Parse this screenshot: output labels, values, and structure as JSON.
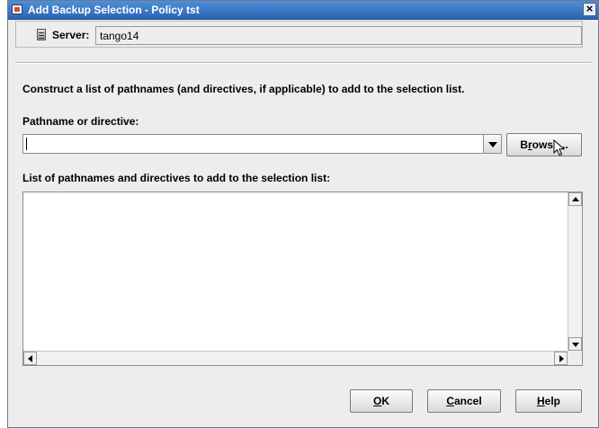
{
  "window": {
    "title": "Add Backup Selection - Policy tst",
    "close_glyph": "×"
  },
  "server": {
    "label": "Server:",
    "value": "tango14",
    "icon": "server-icon"
  },
  "instructions": "Construct a list of pathnames (and directives, if applicable) to add to the selection list.",
  "pathname": {
    "label": "Pathname or directive:",
    "value": "",
    "dropdown_icon": "chevron-down-icon"
  },
  "buttons": {
    "browse": {
      "pre": "B",
      "mnemonic": "r",
      "post": "owse..."
    },
    "ok": {
      "pre": "",
      "mnemonic": "O",
      "post": "K"
    },
    "cancel": {
      "pre": "",
      "mnemonic": "C",
      "post": "ancel"
    },
    "help": {
      "pre": "",
      "mnemonic": "H",
      "post": "elp"
    }
  },
  "list": {
    "label": "List of pathnames and directives to add to the selection list:",
    "items": []
  },
  "colors": {
    "titlebar": "#2b63b5",
    "dialog_bg": "#ededed"
  }
}
